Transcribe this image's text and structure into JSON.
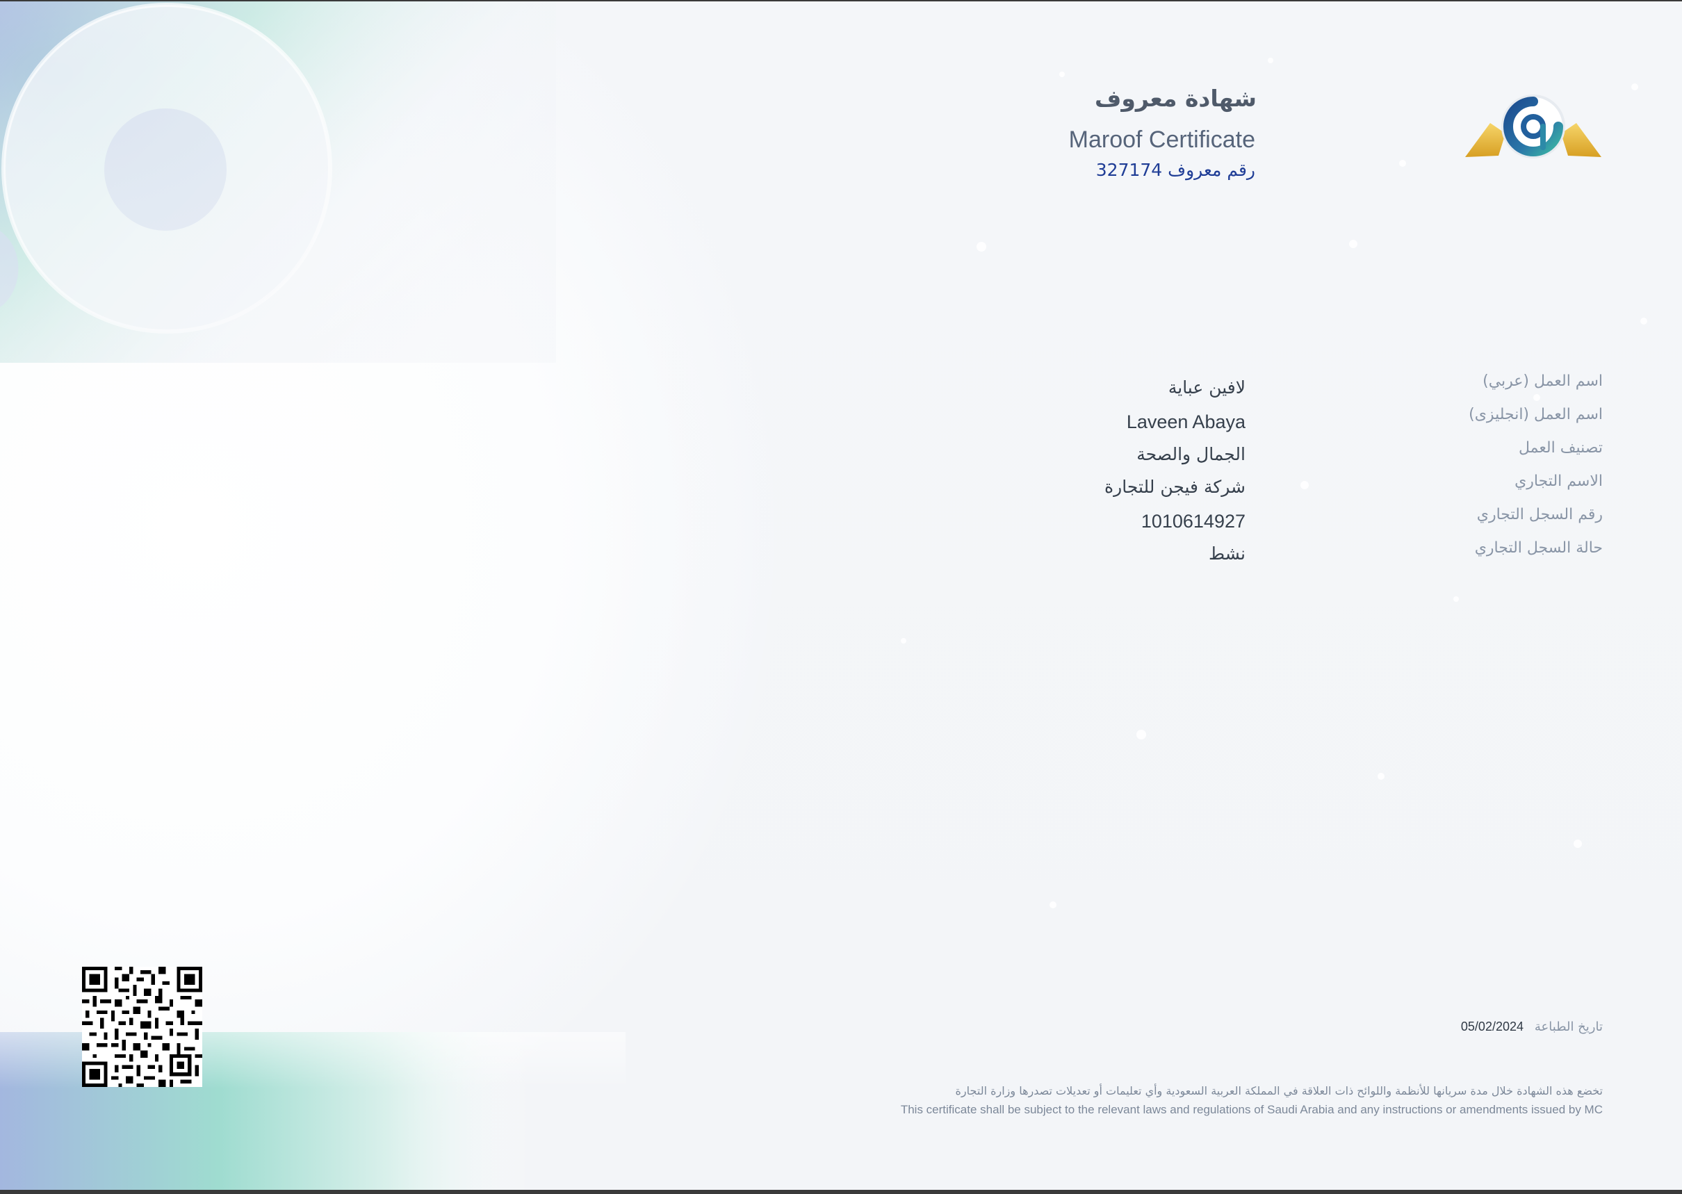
{
  "certificate": {
    "title_ar": "شهادة معروف",
    "title_en": "Maroof Certificate",
    "number_label": "رقم معروف",
    "number": "327174"
  },
  "details": [
    {
      "label": "اسم العمل (عربي)",
      "value": "لافين عباية",
      "lang": "ar"
    },
    {
      "label": "اسم العمل (انجليزى)",
      "value": "Laveen Abaya",
      "lang": "en"
    },
    {
      "label": "تصنيف العمل",
      "value": "الجمال والصحة",
      "lang": "ar"
    },
    {
      "label": "الاسم التجاري",
      "value": "شركة فيجن للتجارة",
      "lang": "ar"
    },
    {
      "label": "رقم السجل التجاري",
      "value": "1010614927",
      "lang": "en"
    },
    {
      "label": "حالة السجل التجاري",
      "value": "نشط",
      "lang": "ar"
    }
  ],
  "footer": {
    "print_date_label": "تاريخ الطباعة",
    "print_date": "05/02/2024",
    "disclaimer_ar": "تخضع هذه الشهادة خلال مدة سريانها للأنظمة واللوائح ذات العلاقة في المملكة العربية السعودية وأي تعليمات أو تعديلات تصدرها وزارة التجارة",
    "disclaimer_en": "This certificate shall be subject to the relevant laws and regulations of Saudi Arabia and any instructions or amendments issued by MC"
  },
  "icons": {
    "logo": "maroof-logo-icon",
    "qr": "qr-code-icon"
  },
  "colors": {
    "accent_blue": "#1f3d96",
    "teal": "#8fd8cc",
    "gold": "#e2b23a"
  }
}
